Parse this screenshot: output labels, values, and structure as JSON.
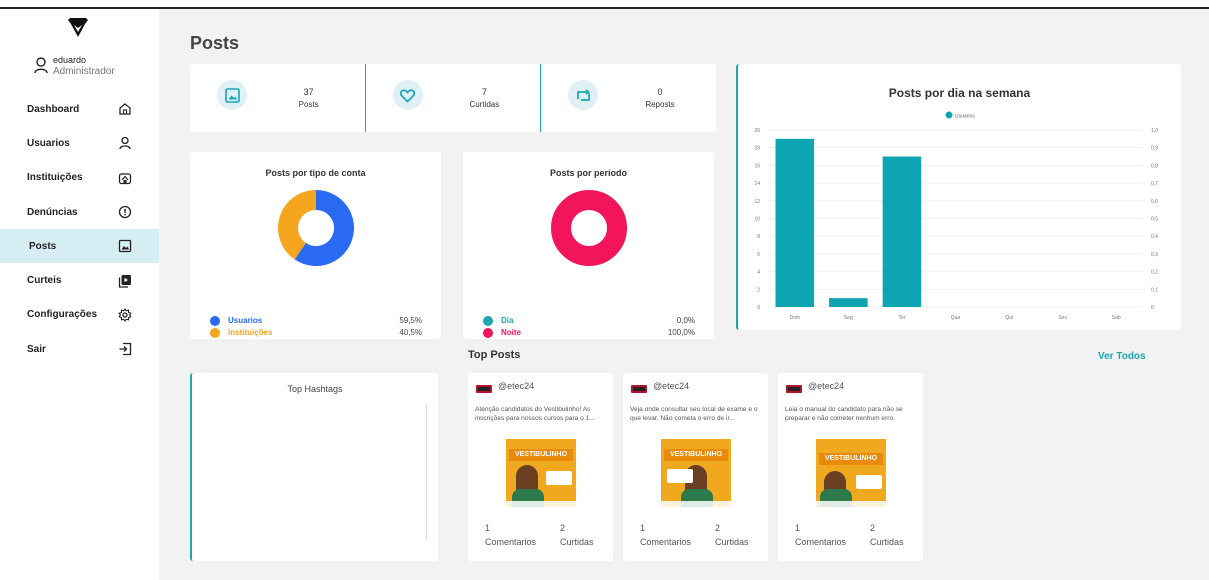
{
  "sidebar": {
    "user": {
      "name": "eduardo",
      "role": "Administrador"
    },
    "items": [
      {
        "label": "Dashboard",
        "icon": "home-icon",
        "active": false
      },
      {
        "label": "Usuarios",
        "icon": "user-icon",
        "active": false
      },
      {
        "label": "Instituições",
        "icon": "institution-icon",
        "active": false
      },
      {
        "label": "Denúncias",
        "icon": "alert-icon",
        "active": false
      },
      {
        "label": "Posts",
        "icon": "image-icon",
        "active": true
      },
      {
        "label": "Curteis",
        "icon": "video-icon",
        "active": false
      },
      {
        "label": "Configurações",
        "icon": "gear-icon",
        "active": false
      },
      {
        "label": "Sair",
        "icon": "logout-icon",
        "active": false
      }
    ]
  },
  "main": {
    "title": "Posts",
    "stats": [
      {
        "value": "37",
        "label": "Posts",
        "icon": "image-icon"
      },
      {
        "value": "7",
        "label": "Curtidas",
        "icon": "heart-icon"
      },
      {
        "value": "0",
        "label": "Reposts",
        "icon": "repost-icon"
      }
    ],
    "accent_color": "#1aa6b3"
  },
  "chart_data": [
    {
      "type": "pie",
      "title": "Posts por tipo de conta",
      "labels": [
        "Usuarios",
        "Instituições"
      ],
      "values": [
        59.5,
        40.5
      ],
      "display_values": [
        "59,5%",
        "40,5%"
      ],
      "colors": [
        "#2a6af2",
        "#f5a51e"
      ]
    },
    {
      "type": "pie",
      "title": "Posts por período",
      "labels": [
        "Dia",
        "Noite"
      ],
      "values": [
        0.0,
        100.0
      ],
      "display_values": [
        "0,0%",
        "100,0%"
      ],
      "colors": [
        "#1aa6b3",
        "#f2155c"
      ]
    },
    {
      "type": "bar",
      "title": "Posts por dia na semana",
      "categories": [
        "Dom",
        "Seg",
        "Ter",
        "Qua",
        "Qui",
        "Sex",
        "Sab"
      ],
      "series": [
        {
          "name": "Usuarios",
          "values": [
            19,
            1,
            17,
            0,
            0,
            0,
            0
          ]
        }
      ],
      "ylim": [
        0,
        20
      ],
      "yticks": [
        "0",
        "2",
        "4",
        "6",
        "8",
        "10",
        "12",
        "14",
        "16",
        "18",
        "20"
      ],
      "y2ticks": [
        "0",
        "0,1",
        "0,2",
        "0,3",
        "0,4",
        "0,5",
        "0,6",
        "0,7",
        "0,8",
        "0,9",
        "1,0"
      ],
      "legend": "top",
      "color": "#0ea5b3"
    }
  ],
  "top_posts": {
    "title": "Top Posts",
    "see_all": "Ver Todos",
    "hashtags_title": "Top Hashtags",
    "posts": [
      {
        "handle": "@etec24",
        "text": "Atenção candidatos do Vestibulinho! As inscrições para nossos cursos para o 1...",
        "image_title": "VESTIBULINHO",
        "comments": "1",
        "comments_label": "Comentarios",
        "likes": "2",
        "likes_label": "Curtidas"
      },
      {
        "handle": "@etec24",
        "text": "Veja onde consultar seu local de exame e o que levar. Não cometa o erro de ir...",
        "image_title": "VESTIBULINHO",
        "comments": "1",
        "comments_label": "Comentarios",
        "likes": "2",
        "likes_label": "Curtidas"
      },
      {
        "handle": "@etec24",
        "text": "Leia o manual do candidato para não se preparar e não cometer nenhum erro.",
        "image_title": "VESTIBULINHO",
        "comments": "1",
        "comments_label": "Comentarios",
        "likes": "2",
        "likes_label": "Curtidas"
      }
    ]
  }
}
